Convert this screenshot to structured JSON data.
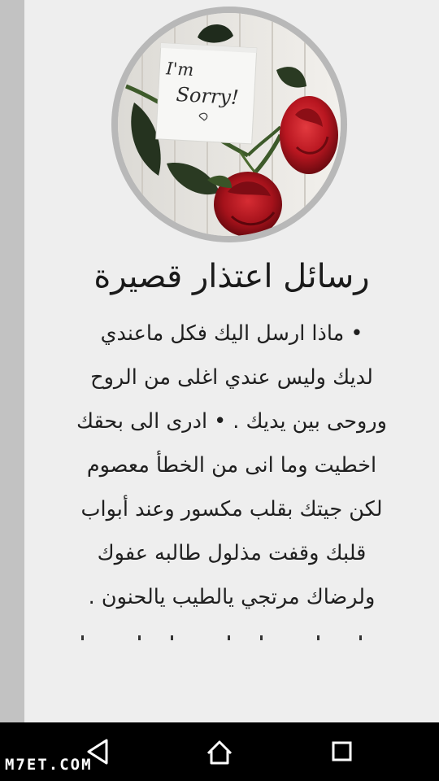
{
  "article": {
    "title": "رسائل اعتذار قصيرة",
    "image": {
      "note_text_line1": "I'm",
      "note_text_line2": "Sorry!"
    },
    "body_lines": [
      "• ماذا ارسل اليك فكل ماعندي",
      "لديك وليس عندي اغلى من الروح",
      "وروحى بين يديك . • ادرى الى بحقك",
      "اخطيت وما انى من الخطأ معصوم",
      "لكن جيتك بقلب مكسور وعند أبواب",
      "قلبك وقفت مذلول طالبه عفوك",
      "ولرضاك مرتجي يالطيب يالحنون ."
    ]
  },
  "nav": {
    "back": "back-icon",
    "home": "home-icon",
    "recents": "recents-icon"
  },
  "watermark": "M7ET.COM",
  "colors": {
    "background": "#eeeeee",
    "left_strip": "#c2c2c2",
    "avatar_ring": "#b8b8b8",
    "navbar": "#000000",
    "rose": "#b81620"
  }
}
